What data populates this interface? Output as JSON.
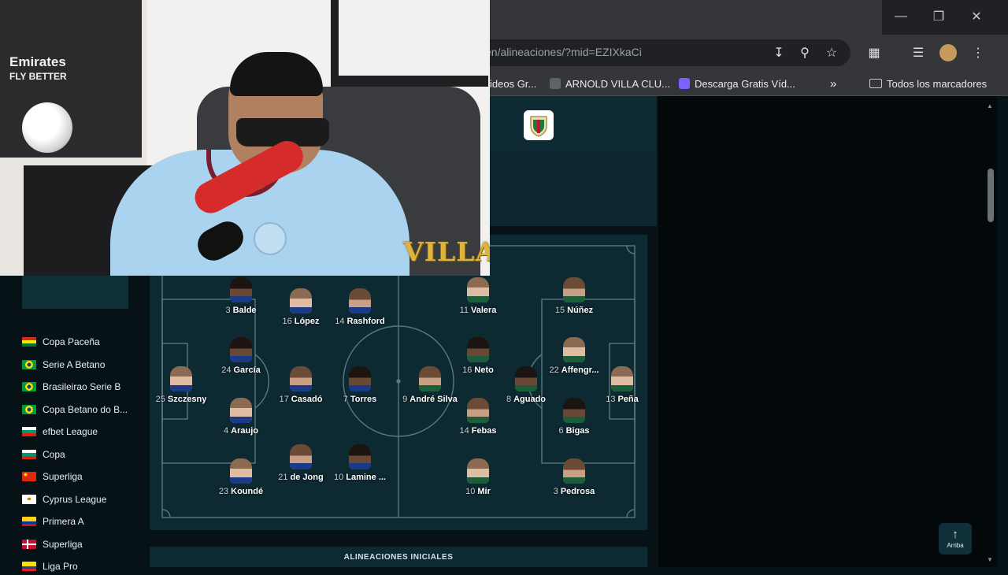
{
  "browser": {
    "url": "en/alineaciones/?mid=EZIXkaCi",
    "window_controls": [
      "minimize",
      "restore",
      "close"
    ],
    "toolbar_icons": [
      "install-icon",
      "zoom-icon",
      "star-icon",
      "extensions-icon",
      "media-icon",
      "profile-avatar",
      "menu-icon"
    ],
    "bookmarks": [
      {
        "label": "ideos Gr...",
        "icon": "page-icon",
        "color": "#9aa0a6"
      },
      {
        "label": "ARNOLD VILLA CLU...",
        "icon": "page-icon",
        "color": "#5f6368"
      },
      {
        "label": "Descarga Gratis Víd...",
        "icon": "play-icon",
        "color": "#7b61ff"
      }
    ],
    "all_bookmarks_label": "Todos los marcadores"
  },
  "sidebar": {
    "leagues": [
      {
        "label": "Copa Paceña",
        "flag": "bolivia"
      },
      {
        "label": "Serie A Betano",
        "flag": "brazil"
      },
      {
        "label": "Brasileirao Serie B",
        "flag": "brazil"
      },
      {
        "label": "Copa Betano do B...",
        "flag": "brazil"
      },
      {
        "label": "efbet League",
        "flag": "bulgaria"
      },
      {
        "label": "Copa",
        "flag": "bulgaria"
      },
      {
        "label": "Superliga",
        "flag": "china"
      },
      {
        "label": "Cyprus League",
        "flag": "cyprus"
      },
      {
        "label": "Primera A",
        "flag": "colombia"
      },
      {
        "label": "Superliga",
        "flag": "denmark"
      },
      {
        "label": "Liga Pro",
        "flag": "ecuador"
      }
    ]
  },
  "lineup": {
    "home": [
      {
        "num": "3",
        "name": "Balde"
      },
      {
        "num": "16",
        "name": "López"
      },
      {
        "num": "14",
        "name": "Rashford"
      },
      {
        "num": "24",
        "name": "García"
      },
      {
        "num": "25",
        "name": "Szczesny"
      },
      {
        "num": "17",
        "name": "Casadó"
      },
      {
        "num": "7",
        "name": "Torres"
      },
      {
        "num": "4",
        "name": "Araujo"
      },
      {
        "num": "21",
        "name": "de Jong"
      },
      {
        "num": "10",
        "name": "Lamine ..."
      },
      {
        "num": "23",
        "name": "Koundé"
      }
    ],
    "away": [
      {
        "num": "11",
        "name": "Valera"
      },
      {
        "num": "15",
        "name": "Núñez"
      },
      {
        "num": "16",
        "name": "Neto"
      },
      {
        "num": "22",
        "name": "Affengr..."
      },
      {
        "num": "9",
        "name": "André Silva"
      },
      {
        "num": "8",
        "name": "Aguado"
      },
      {
        "num": "13",
        "name": "Peña"
      },
      {
        "num": "14",
        "name": "Febas"
      },
      {
        "num": "6",
        "name": "Bigas"
      },
      {
        "num": "10",
        "name": "Mir"
      },
      {
        "num": "3",
        "name": "Pedrosa"
      }
    ]
  },
  "section_label": "ALINEACIONES INICIALES",
  "scroll_top_label": "Arriba",
  "webcam": {
    "logo_text": "VILLA",
    "jersey_text_line1": "Emirates",
    "jersey_text_line2": "FLY BETTER"
  },
  "colors": {
    "page_bg": "#061216",
    "card_bg": "#0d2a33",
    "accent_logo": "#e0b43a"
  }
}
